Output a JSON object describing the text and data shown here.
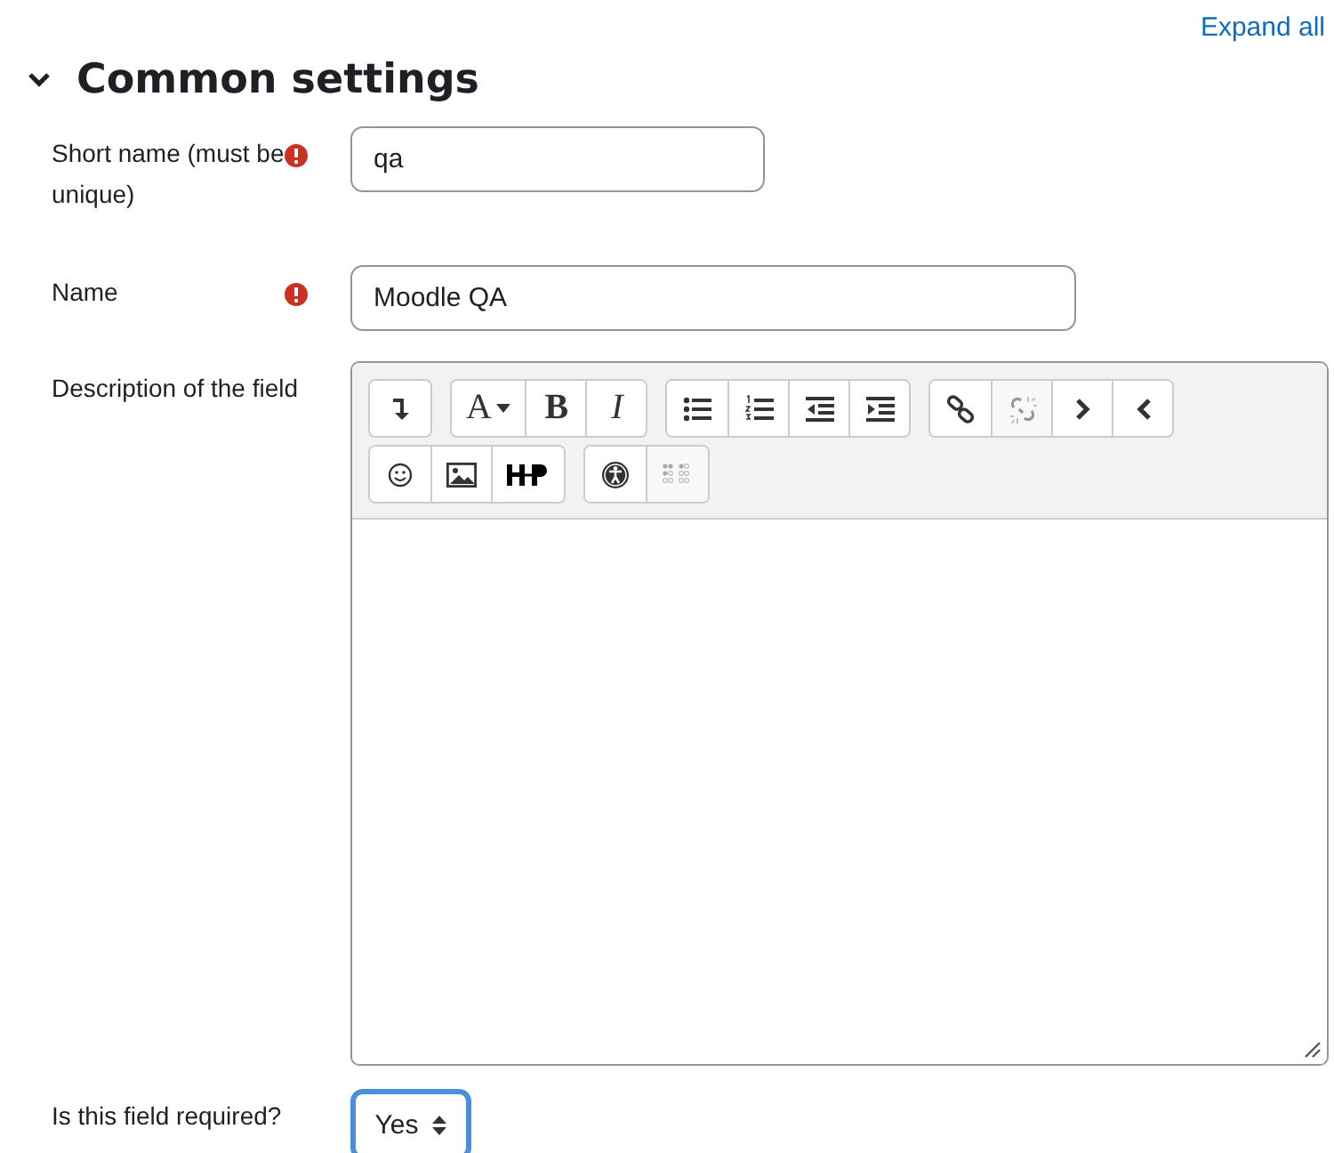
{
  "expand_link": "Expand all",
  "section": {
    "title": "Common settings",
    "expanded": true
  },
  "fields": [
    {
      "kind": "text",
      "label": "Short name (must be unique)",
      "required": true,
      "value": "qa"
    },
    {
      "kind": "text",
      "label": "Name",
      "required": true,
      "value": "Moodle QA"
    },
    {
      "kind": "editor",
      "label": "Description of the field",
      "required": false,
      "toolbar": [
        [
          [
            {
              "kind": "icon",
              "disabled": false
            }
          ],
          [
            {
              "kind": "text",
              "label": "A",
              "caret": true,
              "disabled": false
            },
            {
              "kind": "text",
              "label": "B",
              "caret": false,
              "disabled": false
            },
            {
              "kind": "text",
              "label": "I",
              "caret": false,
              "disabled": false
            }
          ],
          [
            {
              "kind": "icon",
              "disabled": false
            },
            {
              "kind": "icon",
              "disabled": false
            },
            {
              "kind": "icon",
              "disabled": false
            },
            {
              "kind": "icon",
              "disabled": false
            }
          ],
          [
            {
              "kind": "icon",
              "disabled": false
            },
            {
              "kind": "icon",
              "disabled": true
            },
            {
              "kind": "icon",
              "disabled": false
            },
            {
              "kind": "icon",
              "disabled": false
            }
          ]
        ],
        [
          [
            {
              "kind": "icon",
              "disabled": false
            },
            {
              "kind": "icon",
              "disabled": false
            },
            {
              "kind": "icon",
              "disabled": false
            }
          ],
          [
            {
              "kind": "icon",
              "disabled": false
            },
            {
              "kind": "icon",
              "disabled": true
            }
          ]
        ]
      ]
    },
    {
      "kind": "select",
      "label": "Is this field required?",
      "required": false,
      "value": "Yes",
      "focused": true
    }
  ]
}
